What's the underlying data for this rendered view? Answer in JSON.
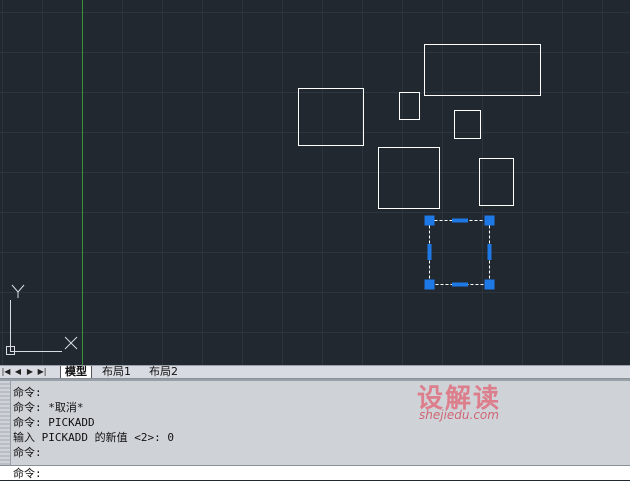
{
  "layout_tabs": [
    {
      "label": "模型",
      "active": true
    },
    {
      "label": "布局1",
      "active": false
    },
    {
      "label": "布局2",
      "active": false
    }
  ],
  "nav_buttons": [
    "|◀",
    "◀",
    "▶",
    "▶|"
  ],
  "ucs": {
    "x_label": "X",
    "y_label": "Y"
  },
  "command_history": [
    "命令:",
    "命令: *取消*",
    "命令: PICKADD",
    "输入 PICKADD 的新值 <2>: 0",
    "命令:"
  ],
  "command_prompt": "命令:",
  "watermark": {
    "title": "设解读",
    "subtitle": "shejiedu.com"
  },
  "colors": {
    "background": "#212830",
    "grid": "#2c3440",
    "axis_y": "#3a8f3a",
    "entity": "#ffffff",
    "grip": "#1e78e6"
  }
}
